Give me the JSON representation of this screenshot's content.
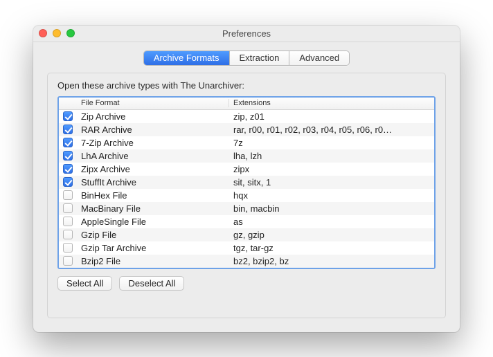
{
  "window_title": "Preferences",
  "tabs": [
    {
      "label": "Archive Formats",
      "active": true
    },
    {
      "label": "Extraction",
      "active": false
    },
    {
      "label": "Advanced",
      "active": false
    }
  ],
  "group_label": "Open these archive types with The Unarchiver:",
  "columns": {
    "format": "File Format",
    "extensions": "Extensions"
  },
  "rows": [
    {
      "checked": true,
      "format": "Zip Archive",
      "ext": "zip, z01"
    },
    {
      "checked": true,
      "format": "RAR Archive",
      "ext": "rar, r00, r01, r02, r03, r04, r05, r06, r0…"
    },
    {
      "checked": true,
      "format": "7-Zip Archive",
      "ext": "7z"
    },
    {
      "checked": true,
      "format": "LhA Archive",
      "ext": "lha, lzh"
    },
    {
      "checked": true,
      "format": "Zipx Archive",
      "ext": "zipx"
    },
    {
      "checked": true,
      "format": "StuffIt Archive",
      "ext": "sit, sitx, 1"
    },
    {
      "checked": false,
      "format": "BinHex File",
      "ext": "hqx"
    },
    {
      "checked": false,
      "format": "MacBinary File",
      "ext": "bin, macbin"
    },
    {
      "checked": false,
      "format": "AppleSingle File",
      "ext": "as"
    },
    {
      "checked": false,
      "format": "Gzip File",
      "ext": "gz, gzip"
    },
    {
      "checked": false,
      "format": "Gzip Tar Archive",
      "ext": "tgz, tar-gz"
    },
    {
      "checked": false,
      "format": "Bzip2 File",
      "ext": "bz2, bzip2, bz"
    }
  ],
  "buttons": {
    "select_all": "Select All",
    "deselect_all": "Deselect All"
  }
}
